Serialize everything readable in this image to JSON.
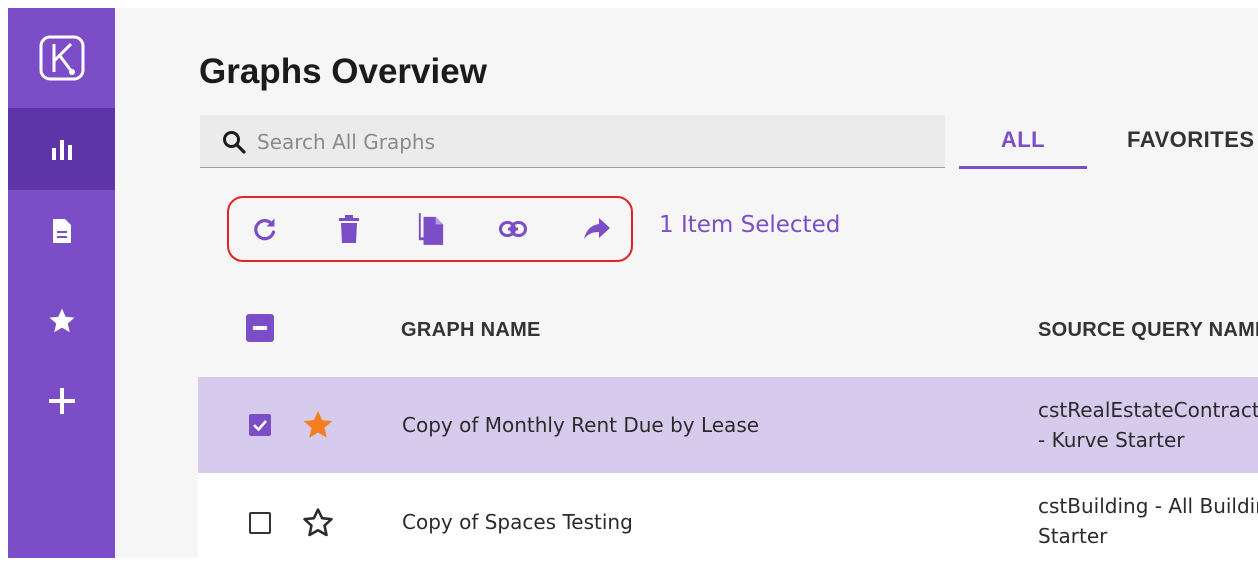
{
  "app": {
    "logo_icon": "kurve-logo-icon"
  },
  "sidebar": {
    "items": [
      {
        "icon": "bar-chart-icon",
        "active": true
      },
      {
        "icon": "document-icon",
        "active": false
      },
      {
        "icon": "star-icon",
        "active": false
      },
      {
        "icon": "plus-icon",
        "active": false
      }
    ]
  },
  "page": {
    "title": "Graphs Overview"
  },
  "search": {
    "placeholder": "Search All Graphs",
    "value": ""
  },
  "tabs": [
    {
      "label": "ALL",
      "active": true
    },
    {
      "label": "FAVORITES",
      "active": false
    }
  ],
  "toolbar": {
    "actions": [
      "refresh-icon",
      "delete-icon",
      "copy-icon",
      "link-icon",
      "share-icon"
    ],
    "selected_text": "1 Item Selected"
  },
  "table": {
    "columns": [
      "GRAPH NAME",
      "SOURCE QUERY NAME"
    ],
    "rows": [
      {
        "selected": true,
        "favorite": true,
        "name": "Copy of Monthly Rent Due by Lease",
        "source_line1": "cstRealEstateContracts",
        "source_line2": "- Kurve Starter"
      },
      {
        "selected": false,
        "favorite": false,
        "name": "Copy of Spaces Testing",
        "source_line1": "cstBuilding - All Buildings",
        "source_line2": "Starter"
      }
    ]
  },
  "colors": {
    "accent": "#7b4ec8",
    "accent_dark": "#5e35a8",
    "highlight_row": "#d6cbec",
    "favorite_star": "#f47d20",
    "annotation_border": "#e32222"
  }
}
